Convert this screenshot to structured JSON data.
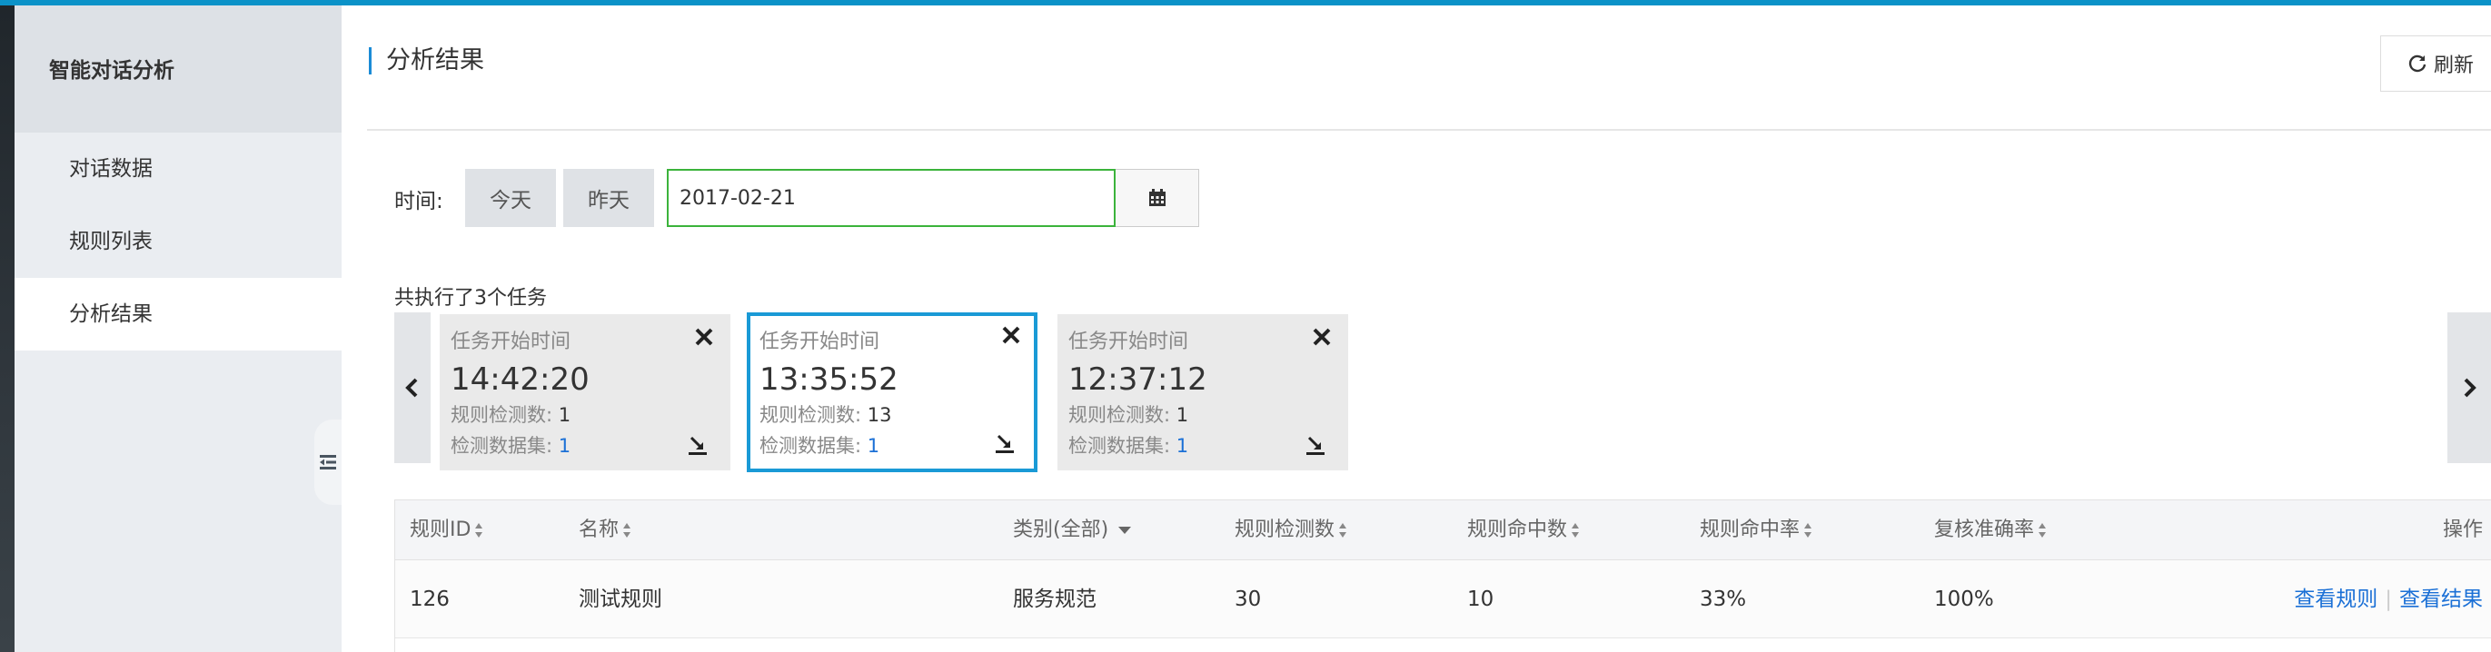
{
  "sidebar": {
    "title": "智能对话分析",
    "items": [
      {
        "label": "对话数据"
      },
      {
        "label": "规则列表"
      },
      {
        "label": "分析结果"
      }
    ]
  },
  "header": {
    "title": "分析结果",
    "refresh_label": "刷新"
  },
  "filter": {
    "time_label": "时间:",
    "today_label": "今天",
    "yesterday_label": "昨天",
    "date_value": "2017-02-21"
  },
  "tasks": {
    "summary": "共执行了3个任务",
    "cards": [
      {
        "start_label": "任务开始时间",
        "time": "14:42:20",
        "rule_count_label": "规则检测数:",
        "rule_count": "1",
        "dataset_label": "检测数据集:",
        "dataset": "1"
      },
      {
        "start_label": "任务开始时间",
        "time": "13:35:52",
        "rule_count_label": "规则检测数:",
        "rule_count": "13",
        "dataset_label": "检测数据集:",
        "dataset": "1"
      },
      {
        "start_label": "任务开始时间",
        "time": "12:37:12",
        "rule_count_label": "规则检测数:",
        "rule_count": "1",
        "dataset_label": "检测数据集:",
        "dataset": "1"
      }
    ]
  },
  "table": {
    "headers": {
      "rule_id": "规则ID",
      "name": "名称",
      "category": "类别(全部)",
      "detect_count": "规则检测数",
      "hit_count": "规则命中数",
      "hit_rate": "规则命中率",
      "review_accuracy": "复核准确率",
      "actions": "操作"
    },
    "rows": [
      {
        "rule_id": "126",
        "name": "测试规则",
        "category": "服务规范",
        "detect_count": "30",
        "hit_count": "10",
        "hit_rate": "33%",
        "review_accuracy": "100%",
        "view_rule": "查看规则",
        "view_result": "查看结果"
      }
    ]
  }
}
